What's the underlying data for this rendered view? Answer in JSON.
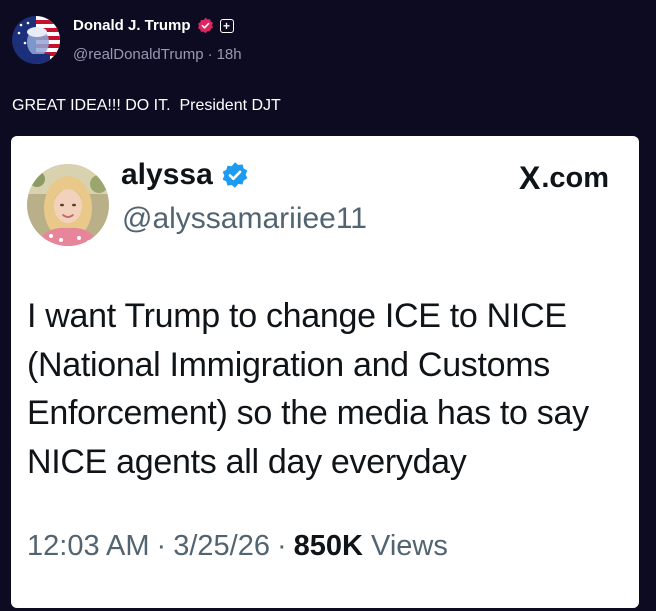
{
  "post": {
    "author_name": "Donald J. Trump",
    "handle": "@realDonaldTrump",
    "separator": "·",
    "time_ago": "18h",
    "text": "GREAT IDEA!!! DO IT.  President DJT",
    "plus_badge": "+",
    "avatar_icon": "flag-portrait-avatar",
    "verified_icon": "verified-badge-red"
  },
  "quoted": {
    "name": "alyssa",
    "handle": "@alyssamariiee11",
    "source": ".com",
    "source_x": "X",
    "verified_icon": "verified-badge-blue",
    "lines": [
      "I want Trump to change ICE to NICE",
      "(National Immigration and Customs",
      "Enforcement) so the media has to say",
      "NICE agents all day everyday"
    ],
    "time": "12:03 AM",
    "date": "3/25/26",
    "separator": "·",
    "views_count": "850K",
    "views_label": "Views"
  },
  "colors": {
    "background": "#0d0b22",
    "card": "#ffffff",
    "verified_blue": "#1d9bf0",
    "verified_red": "#e0245e",
    "muted": "#536471"
  }
}
